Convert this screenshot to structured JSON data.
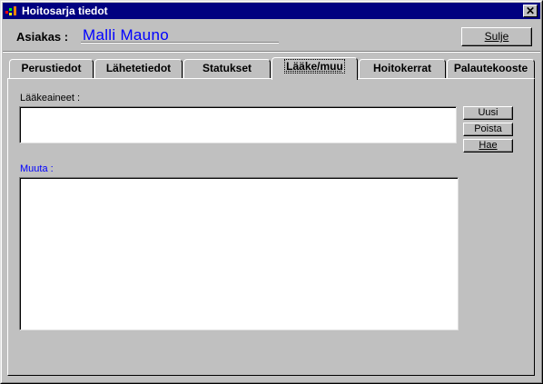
{
  "window": {
    "title": "Hoitosarja tiedot",
    "close_label": "✕"
  },
  "header": {
    "asiakas_label": "Asiakas :",
    "asiakas_value": "Malli Mauno",
    "sulje_label": "Sulje"
  },
  "tabs": [
    {
      "label": "Perustiedot",
      "active": false
    },
    {
      "label": "Lähetetiedot",
      "active": false
    },
    {
      "label": "Statukset",
      "active": false
    },
    {
      "label": "Lääke/muu",
      "active": true
    },
    {
      "label": "Hoitokerrat",
      "active": false
    },
    {
      "label": "Palautekooste",
      "active": false
    }
  ],
  "panel": {
    "laakeaineet_label": "Lääkeaineet :",
    "laakeaineet_value": "",
    "muuta_label": "Muuta :",
    "muuta_value": "",
    "buttons": {
      "uusi": "Uusi",
      "poista": "Poista",
      "hae": "Hae"
    }
  },
  "colors": {
    "titlebar": "#000080",
    "link_blue": "#0000ff",
    "face": "#c0c0c0"
  },
  "icons": {
    "app": "app-icon",
    "close": "close-icon"
  }
}
